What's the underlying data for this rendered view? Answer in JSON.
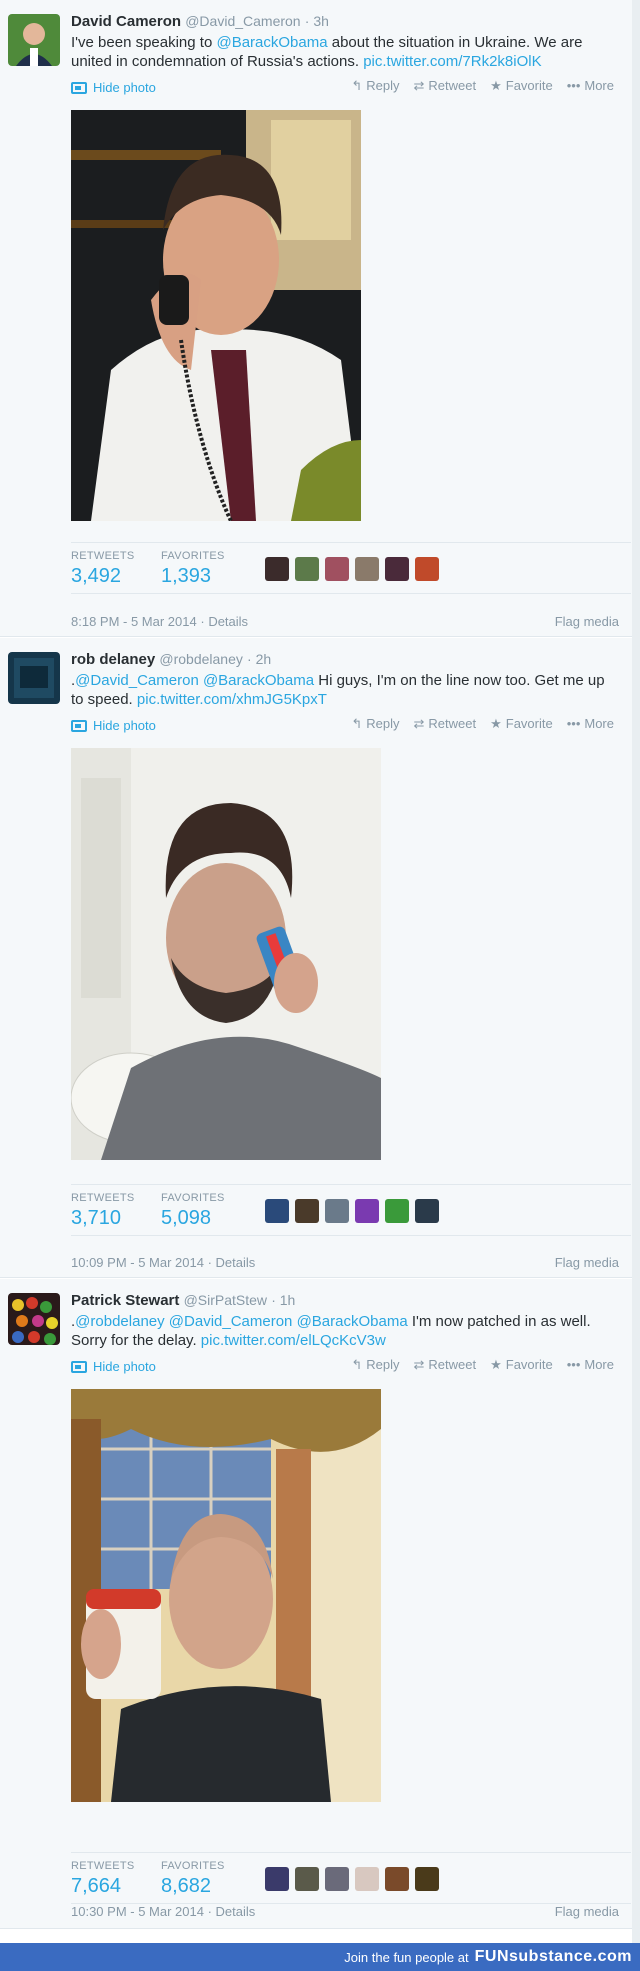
{
  "tweets": [
    {
      "name": "David Cameron",
      "handle": "@David_Cameron",
      "time": "· 3h",
      "text_before": "I've been speaking to ",
      "mentions": "@BarackObama",
      "text_after": " about the situation in Ukraine. We are united in condemnation of Russia's actions. ",
      "link": "pic.twitter.com/7Rk2k8iOlK",
      "retweets": "3,492",
      "favorites": "1,393",
      "timestamp": "8:18 PM - 5 Mar 2014",
      "details": "Details",
      "flag": "Flag media"
    },
    {
      "name": "rob delaney",
      "handle": "@robdelaney",
      "time": "· 2h",
      "text_before": ".",
      "mentions": "@David_Cameron @BarackObama",
      "text_after": " Hi guys, I'm on the line now too. Get me up to speed. ",
      "link": "pic.twitter.com/xhmJG5KpxT",
      "retweets": "3,710",
      "favorites": "5,098",
      "timestamp": "10:09 PM - 5 Mar 2014",
      "details": "Details",
      "flag": "Flag media"
    },
    {
      "name": "Patrick Stewart",
      "handle": "@SirPatStew",
      "time": "· 1h",
      "text_before": ".",
      "mentions": "@robdelaney @David_Cameron @BarackObama",
      "text_after": " I'm now patched in as well. Sorry for the delay. ",
      "link": "pic.twitter.com/elLQcKcV3w",
      "retweets": "7,664",
      "favorites": "8,682",
      "timestamp": "10:30 PM - 5 Mar 2014",
      "details": "Details",
      "flag": "Flag media"
    }
  ],
  "labels": {
    "hide_photo": "Hide photo",
    "reply": "Reply",
    "retweet": "Retweet",
    "favorite": "Favorite",
    "more": "More",
    "retweets": "RETWEETS",
    "favorites": "FAVORITES"
  },
  "icons": {
    "reply": "reply-icon",
    "retweet": "retweet-icon",
    "favorite": "star-icon",
    "more": "more-dots-icon",
    "hide_photo": "photo-icon"
  },
  "banner": {
    "text": "Join the fun people at",
    "brand": "FUNsubstance.com"
  },
  "colors": {
    "link": "#2aa6e0",
    "banner": "#3a6bc1"
  }
}
